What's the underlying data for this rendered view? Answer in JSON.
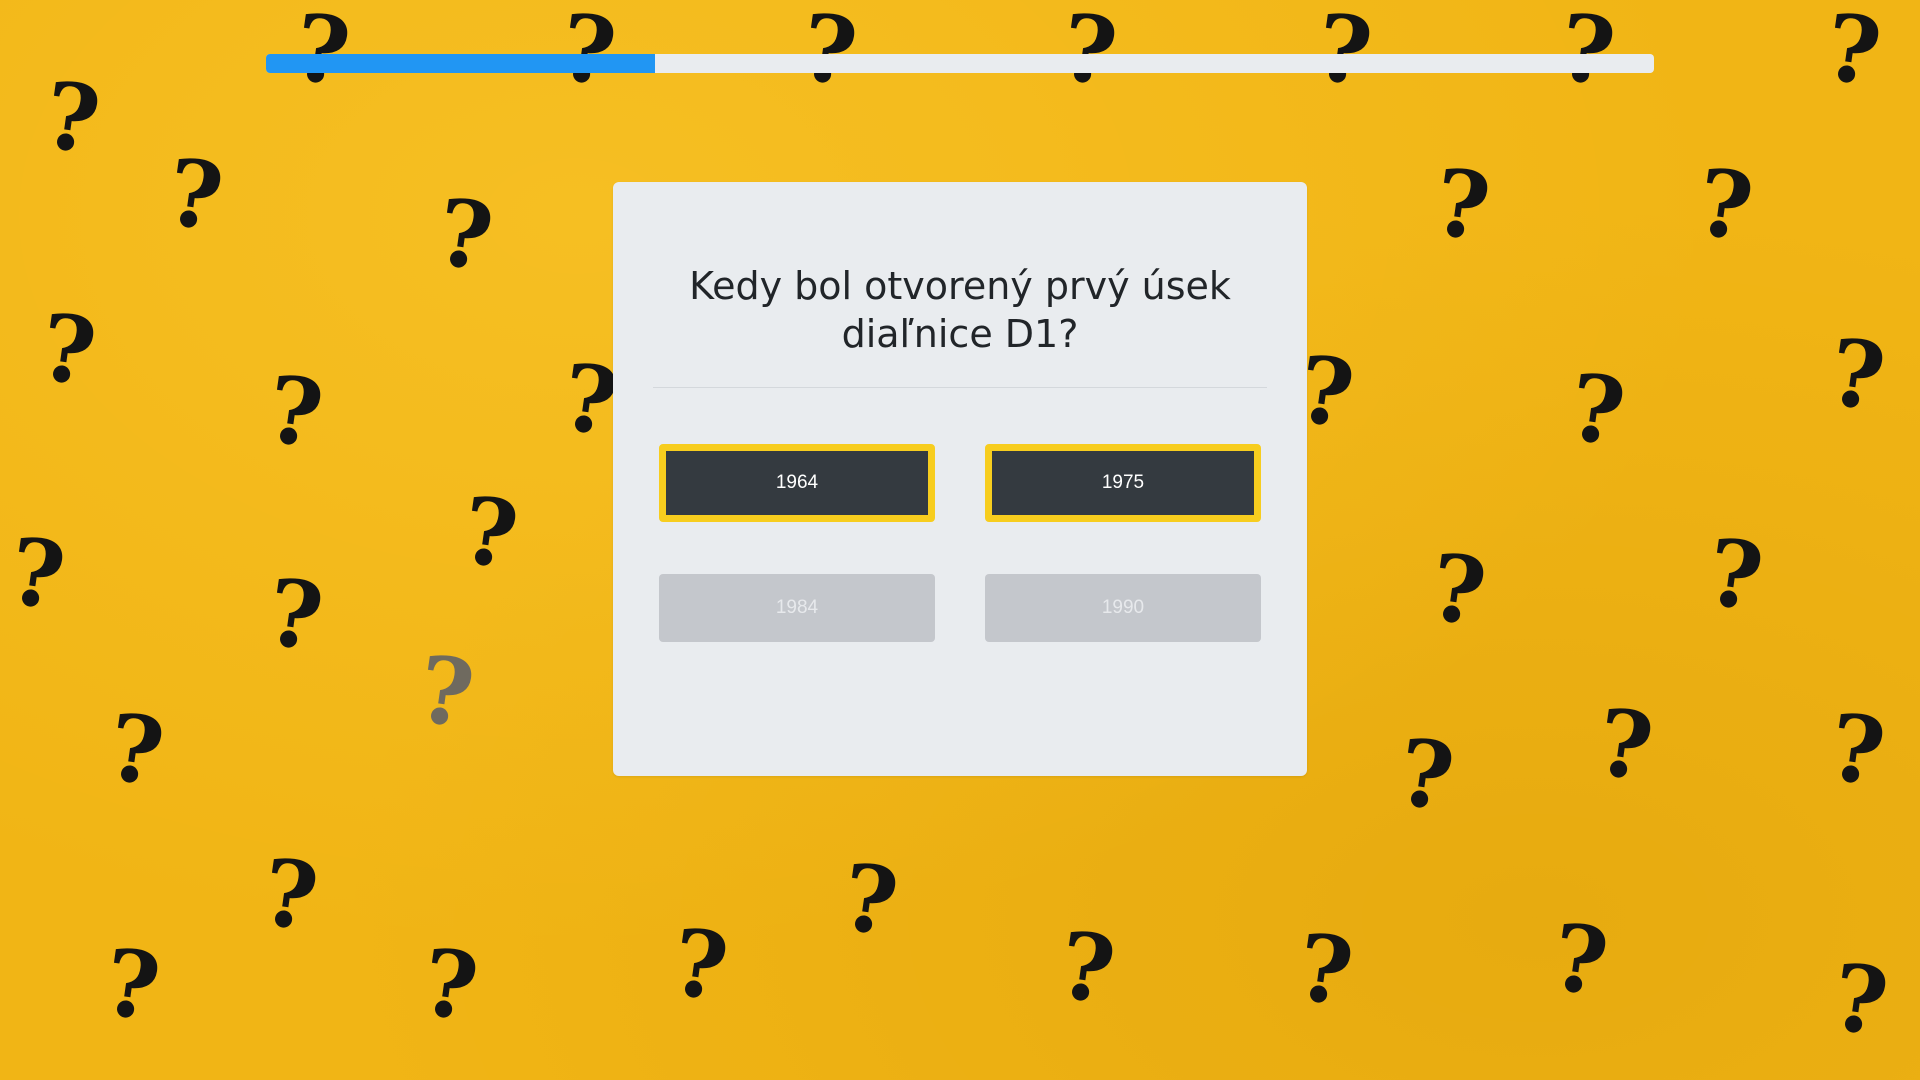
{
  "quiz": {
    "question": "Kedy bol otvorený prvý úsek diaľnice D1?",
    "progress_percent": 28,
    "answers": [
      {
        "label": "1964",
        "state": "active"
      },
      {
        "label": "1975",
        "state": "active"
      },
      {
        "label": "1984",
        "state": "disabled"
      },
      {
        "label": "1990",
        "state": "disabled"
      }
    ]
  },
  "background": {
    "pattern": "question-mark",
    "color": "#f1b515"
  },
  "colors": {
    "progress_fill": "#2196f3",
    "progress_track": "#e9ecef",
    "card_background": "#e9ecef",
    "button_dark": "#343a40",
    "button_border": "#f7cd1e",
    "button_disabled": "#c4c7cc"
  }
}
